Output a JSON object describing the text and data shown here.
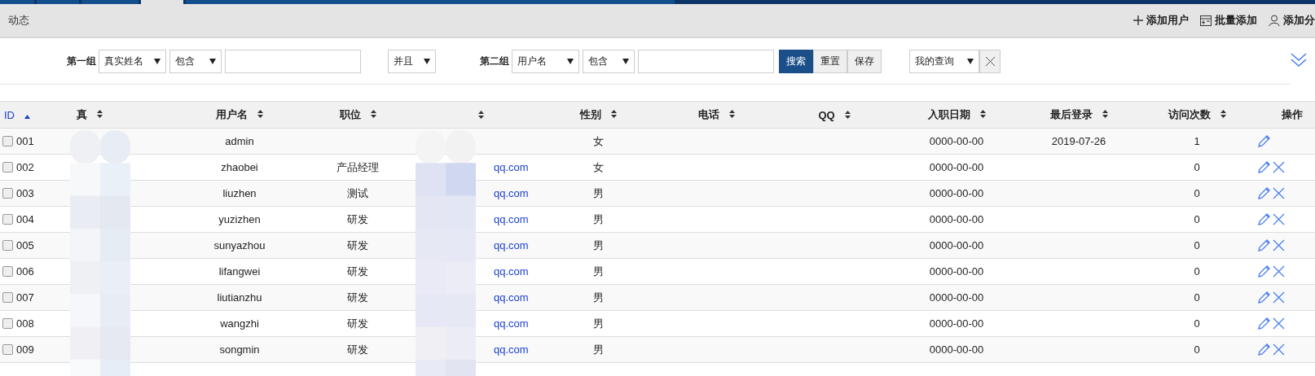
{
  "top_tabs": [
    {
      "selected": false
    },
    {
      "selected": false
    },
    {
      "selected": false
    },
    {
      "selected": true
    },
    {
      "selected": false
    }
  ],
  "toolbar": {
    "title": "动态",
    "actions": [
      {
        "kind": "plus",
        "label": "添加用户"
      },
      {
        "kind": "batch",
        "label": "批量添加"
      },
      {
        "kind": "user",
        "label": "添加分"
      }
    ]
  },
  "filters": {
    "group1": {
      "label": "第一组",
      "field": "真实姓名",
      "operator": "包含"
    },
    "joiner": "并且",
    "group2": {
      "label": "第二组",
      "field": "用户名",
      "operator": "包含"
    },
    "buttons": [
      {
        "label": "搜索",
        "kind": "primary"
      },
      {
        "label": "重置",
        "kind": "default"
      },
      {
        "label": "保存",
        "kind": "default"
      }
    ],
    "saved_query": "我的查询"
  },
  "table": {
    "columns": [
      {
        "label": "ID",
        "sorted": true
      },
      {
        "label": "真",
        "sorted": false
      },
      {
        "label": "用户名",
        "sorted": false
      },
      {
        "label": "职位",
        "sorted": false
      },
      {
        "sorted": false
      },
      {
        "label": "性别",
        "sorted": false
      },
      {
        "label": "电话",
        "sorted": false
      },
      {
        "label": "QQ",
        "sorted": false
      },
      {
        "label": "入职日期",
        "sorted": false
      },
      {
        "label": "最后登录",
        "sorted": false
      },
      {
        "label": "访问次数",
        "sorted": false
      },
      {
        "label": "操作",
        "sortable": false
      }
    ],
    "rows": [
      {
        "checked": false,
        "id": "001",
        "username": "admin",
        "gender": "女",
        "hired": "0000-00-00",
        "last_login": "2019-07-26",
        "visits": "1",
        "actions": [
          {
            "kind": "edit"
          }
        ]
      },
      {
        "checked": false,
        "id": "002",
        "username": "zhaobei",
        "position": "产品经理",
        "email": "qq.com",
        "gender": "女",
        "hired": "0000-00-00",
        "visits": "0",
        "actions": [
          {
            "kind": "edit"
          },
          {
            "kind": "delete"
          }
        ]
      },
      {
        "checked": false,
        "id": "003",
        "username": "liuzhen",
        "position": "测试",
        "email": "qq.com",
        "gender": "男",
        "hired": "0000-00-00",
        "visits": "0",
        "actions": [
          {
            "kind": "edit"
          },
          {
            "kind": "delete"
          }
        ]
      },
      {
        "checked": false,
        "id": "004",
        "username": "yuzizhen",
        "position": "研发",
        "email": "qq.com",
        "gender": "男",
        "hired": "0000-00-00",
        "visits": "0",
        "actions": [
          {
            "kind": "edit"
          },
          {
            "kind": "delete"
          }
        ]
      },
      {
        "checked": false,
        "id": "005",
        "username": "sunyazhou",
        "position": "研发",
        "email": "qq.com",
        "gender": "男",
        "hired": "0000-00-00",
        "visits": "0",
        "actions": [
          {
            "kind": "edit"
          },
          {
            "kind": "delete"
          }
        ]
      },
      {
        "checked": false,
        "id": "006",
        "username": "lifangwei",
        "position": "研发",
        "email": "qq.com",
        "gender": "男",
        "hired": "0000-00-00",
        "visits": "0",
        "actions": [
          {
            "kind": "edit"
          },
          {
            "kind": "delete"
          }
        ]
      },
      {
        "checked": false,
        "id": "007",
        "username": "liutianzhu",
        "position": "研发",
        "email": "qq.com",
        "gender": "男",
        "hired": "0000-00-00",
        "visits": "0",
        "actions": [
          {
            "kind": "edit"
          },
          {
            "kind": "delete"
          }
        ]
      },
      {
        "checked": false,
        "id": "008",
        "username": "wangzhi",
        "position": "研发",
        "email": "qq.com",
        "gender": "男",
        "hired": "0000-00-00",
        "visits": "0",
        "actions": [
          {
            "kind": "edit"
          },
          {
            "kind": "delete"
          }
        ]
      },
      {
        "checked": false,
        "id": "009",
        "username": "songmin",
        "position": "研发",
        "email": "qq.com",
        "gender": "男",
        "hired": "0000-00-00",
        "visits": "0",
        "actions": [
          {
            "kind": "edit"
          },
          {
            "kind": "delete"
          }
        ]
      }
    ]
  }
}
